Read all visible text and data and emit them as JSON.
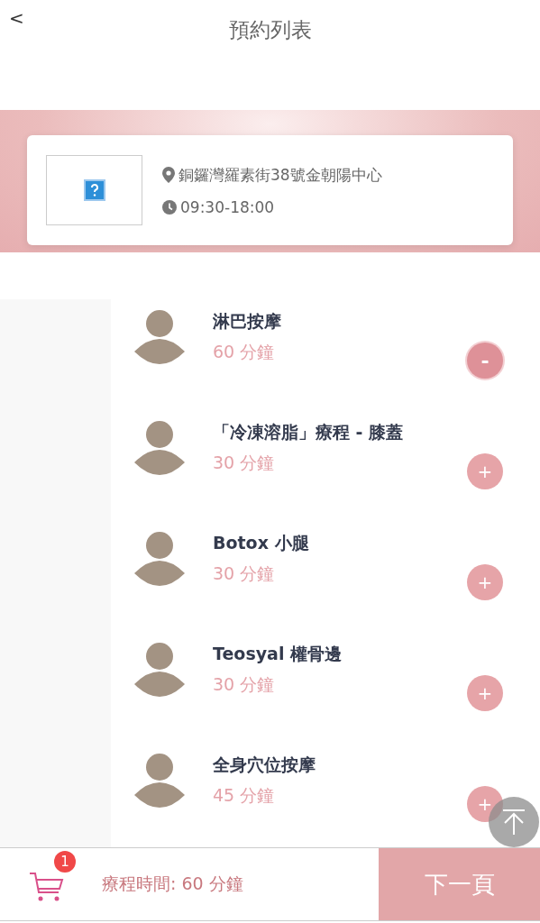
{
  "header": {
    "back": "<",
    "title": "預約列表"
  },
  "store": {
    "address": "銅鑼灣羅素街38號金朝陽中心",
    "hours": "09:30-18:00"
  },
  "services": [
    {
      "name": "淋巴按摩",
      "duration": "60 分鐘",
      "button": "-",
      "selected": true
    },
    {
      "name": "「冷凍溶脂」療程 - 膝蓋",
      "duration": "30 分鐘",
      "button": "+",
      "selected": false
    },
    {
      "name": "Botox 小腿",
      "duration": "30 分鐘",
      "button": "+",
      "selected": false
    },
    {
      "name": "Teosyal 權骨邊",
      "duration": "30 分鐘",
      "button": "+",
      "selected": false
    },
    {
      "name": "全身穴位按摩",
      "duration": "45 分鐘",
      "button": "+",
      "selected": false
    }
  ],
  "footer": {
    "cart_count": "1",
    "total": "療程時間: 60 分鐘",
    "next": "下一頁"
  }
}
